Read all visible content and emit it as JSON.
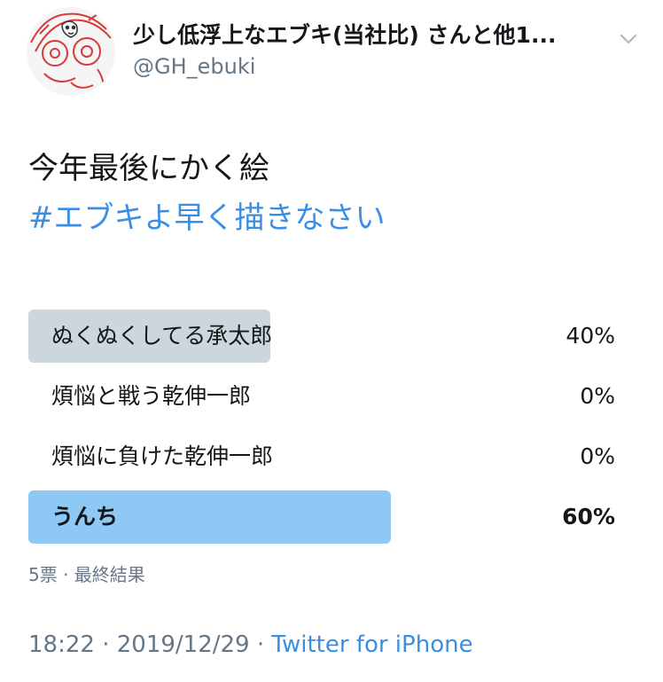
{
  "author": {
    "display_name": "少し低浮上なエブキ(当社比) さんと他1...",
    "handle": "@GH_ebuki"
  },
  "tweet": {
    "text": "今年最後にかく絵",
    "hashtag": "#エブキよ早く描きなさい"
  },
  "poll": {
    "options": [
      {
        "label": "ぬくぬくしてる承太郎",
        "percent_text": "40%",
        "percent": 40
      },
      {
        "label": "煩悩と戦う乾伸一郎",
        "percent_text": "0%",
        "percent": 0
      },
      {
        "label": "煩悩に負けた乾伸一郎",
        "percent_text": "0%",
        "percent": 0
      },
      {
        "label": "うんち",
        "percent_text": "60%",
        "percent": 60
      }
    ],
    "meta": "5票 · 最終結果"
  },
  "footer": {
    "time": "18:22",
    "separator1": " · ",
    "date": "2019/12/29",
    "separator2": " · ",
    "source": "Twitter for iPhone"
  },
  "colors": {
    "link": "#3a8ee6",
    "winner_bar": "#8ec8f4",
    "loser_bar": "#ccd6dd",
    "muted_text": "#657786"
  },
  "icons": {
    "caret": "chevron-down-icon"
  }
}
